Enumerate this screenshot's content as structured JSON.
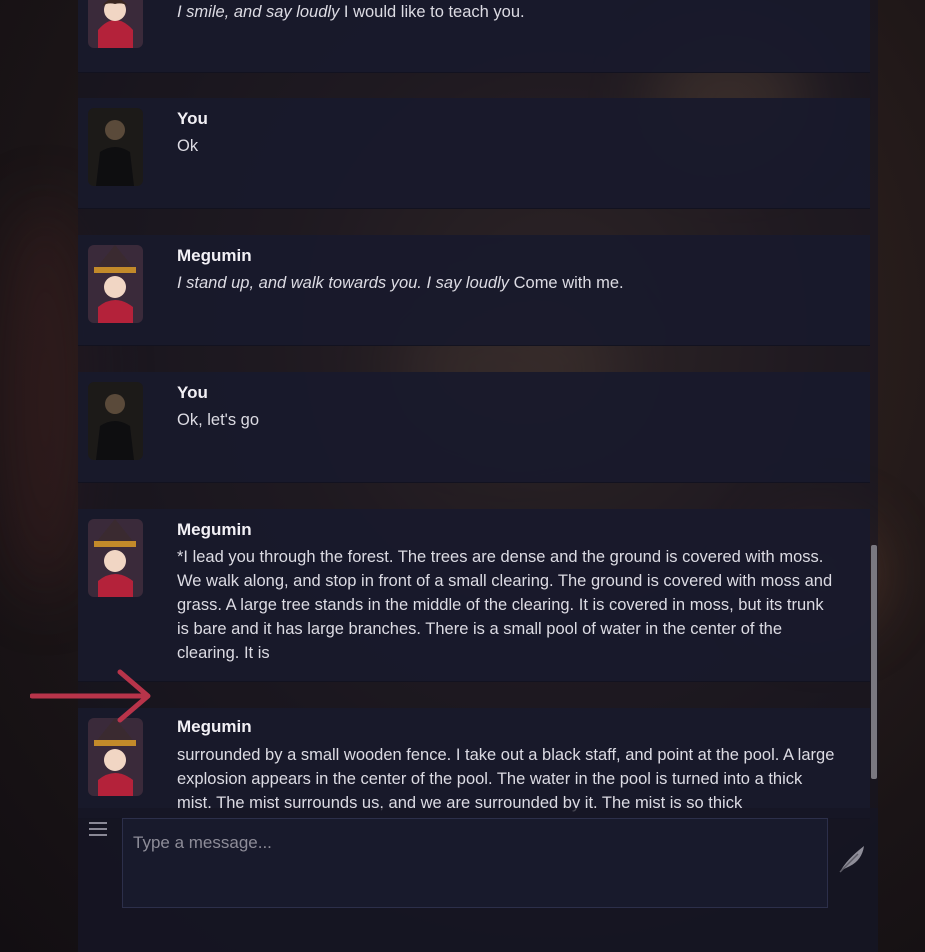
{
  "messages": [
    {
      "name": "",
      "italic": "I smile, and say loudly",
      "text": " I would like to teach you.",
      "avatar": "megumin-avatar"
    },
    {
      "name": "You",
      "italic": "",
      "text": "Ok",
      "avatar": "user-avatar"
    },
    {
      "name": "Megumin",
      "italic": "I stand up, and walk towards you. I say loudly",
      "text": " Come with me.",
      "avatar": "megumin-avatar"
    },
    {
      "name": "You",
      "italic": "",
      "text": "Ok, let's go",
      "avatar": "user-avatar"
    },
    {
      "name": "Megumin",
      "italic": "",
      "text": "*I lead you through the forest. The trees are dense and the ground is covered with moss. We walk along, and stop in front of a small clearing. The ground is covered with moss and grass. A large tree stands in the middle of the clearing. It is covered in moss, but its trunk is bare and it has large branches. There is a small pool of water in the center of the clearing. It is",
      "avatar": "megumin-avatar"
    },
    {
      "name": "Megumin",
      "italic": "",
      "text": "surrounded by a small wooden fence. I take out a black staff, and point at the pool. A large explosion appears in the center of the pool. The water in the pool is turned into a thick mist. The mist surrounds us, and we are surrounded by it. The mist is so thick",
      "avatar": "megumin-avatar"
    }
  ],
  "input": {
    "placeholder": "Type a message..."
  },
  "icons": {
    "menu": "hamburger-menu-icon",
    "send": "feather-send-icon",
    "arrow": "arrow-right-icon"
  },
  "colors": {
    "arrow": "#b8344a",
    "panel": "#181a2c"
  }
}
